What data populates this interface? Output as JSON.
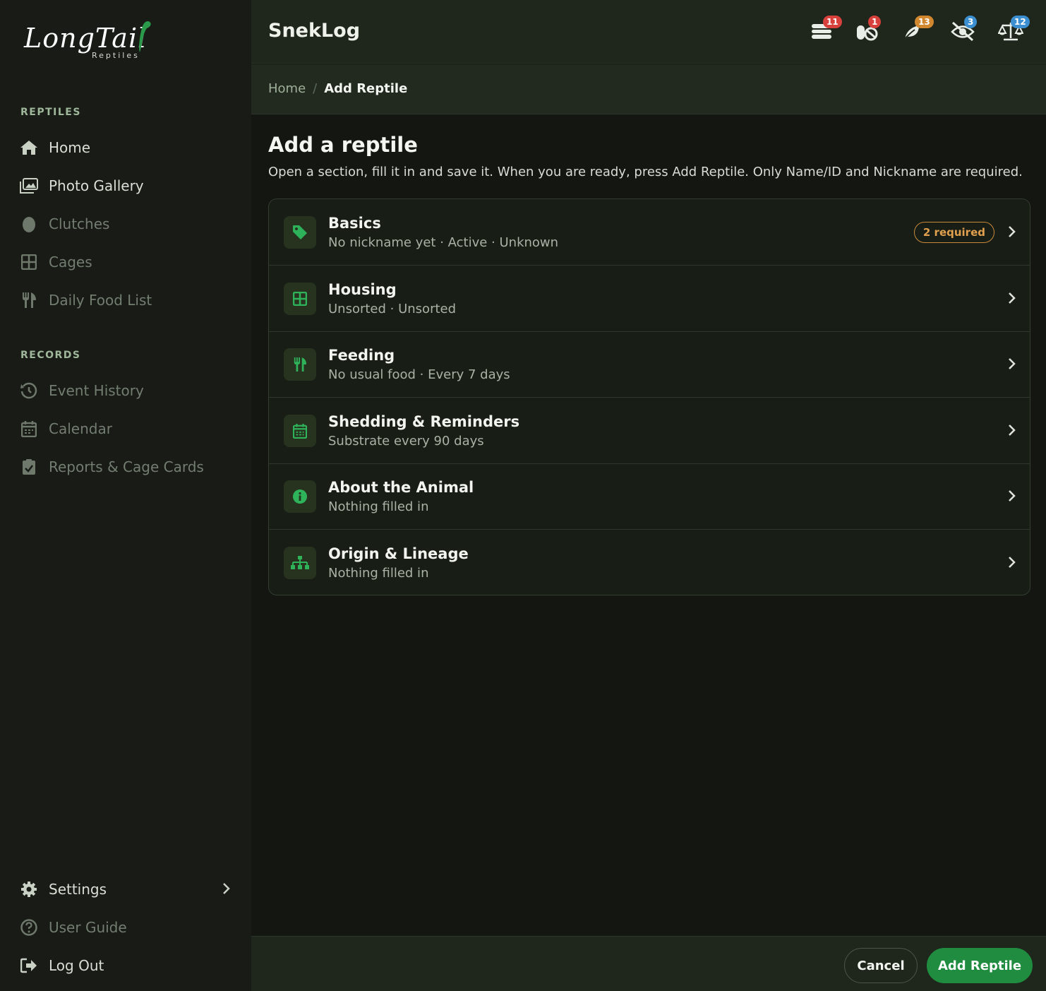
{
  "sidebar": {
    "logo": {
      "main": "LongTail",
      "sub": "Reptiles"
    },
    "sections": [
      {
        "title": "REPTILES",
        "items": [
          {
            "label": "Home",
            "icon": "home-icon"
          },
          {
            "label": "Photo Gallery",
            "icon": "photo-gallery-icon"
          },
          {
            "label": "Clutches",
            "icon": "egg-icon"
          },
          {
            "label": "Cages",
            "icon": "grid-icon"
          },
          {
            "label": "Daily Food List",
            "icon": "utensils-icon"
          }
        ]
      },
      {
        "title": "RECORDS",
        "items": [
          {
            "label": "Event History",
            "icon": "history-icon"
          },
          {
            "label": "Calendar",
            "icon": "calendar-icon"
          },
          {
            "label": "Reports & Cage Cards",
            "icon": "clipboard-check-icon"
          }
        ]
      }
    ],
    "bottom": [
      {
        "label": "Settings",
        "icon": "gear-icon"
      },
      {
        "label": "User Guide",
        "icon": "question-circle-icon"
      },
      {
        "label": "Log Out",
        "icon": "logout-icon"
      }
    ]
  },
  "header": {
    "title": "SnekLog",
    "icons": [
      {
        "name": "feeding-stack-icon",
        "badge": "11",
        "badge_color": "#d8403c"
      },
      {
        "name": "medication-icon",
        "badge": "1",
        "badge_color": "#d8403c"
      },
      {
        "name": "shedding-leaf-icon",
        "badge": "13",
        "badge_color": "#d0872e"
      },
      {
        "name": "eye-slash-icon",
        "badge": "3",
        "badge_color": "#3b8fd0"
      },
      {
        "name": "scale-icon",
        "badge": "12",
        "badge_color": "#3b8fd0"
      }
    ]
  },
  "breadcrumb": {
    "home": "Home",
    "separator": "/",
    "current": "Add Reptile"
  },
  "main": {
    "title": "Add a reptile",
    "description": "Open a section, fill it in and save it. When you are ready, press Add Reptile. Only Name/ID and Nickname are required.",
    "sections": [
      {
        "title": "Basics",
        "subtitle": "No nickname yet · Active · Unknown",
        "icon": "tag-icon",
        "badge": "2 required"
      },
      {
        "title": "Housing",
        "subtitle": "Unsorted · Unsorted",
        "icon": "grid-icon"
      },
      {
        "title": "Feeding",
        "subtitle": "No usual food · Every 7 days",
        "icon": "utensils-icon"
      },
      {
        "title": "Shedding & Reminders",
        "subtitle": "Substrate every 90 days",
        "icon": "calendar-icon"
      },
      {
        "title": "About the Animal",
        "subtitle": "Nothing filled in",
        "icon": "info-icon"
      },
      {
        "title": "Origin & Lineage",
        "subtitle": "Nothing filled in",
        "icon": "sitemap-icon"
      }
    ]
  },
  "footer": {
    "cancel": "Cancel",
    "submit": "Add Reptile"
  },
  "colors": {
    "accent": "#1f8c3f",
    "icon_green": "#2fb35a",
    "warning": "#e0a04e"
  }
}
